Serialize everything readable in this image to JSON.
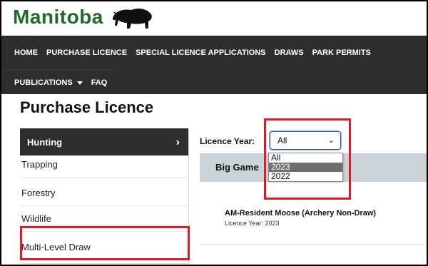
{
  "header": {
    "logo_text": "Manitoba",
    "brand_color": "#1f6b2a"
  },
  "nav": {
    "row1": [
      "HOME",
      "PURCHASE LICENCE",
      "SPECIAL LICENCE APPLICATIONS",
      "DRAWS",
      "PARK PERMITS"
    ],
    "publications_label": "PUBLICATIONS",
    "faq_label": "FAQ",
    "icons": {
      "publications_caret": "caret-down-icon"
    }
  },
  "page": {
    "title": "Purchase Licence"
  },
  "sidebar": {
    "items": [
      {
        "label": "Hunting",
        "active": true,
        "icon": "chevron-right-icon"
      },
      {
        "label": "Trapping"
      },
      {
        "label": "Forestry"
      },
      {
        "label": "Wildlife"
      },
      {
        "label": "Multi-Level Draw",
        "highlighted": true
      }
    ]
  },
  "filter": {
    "year_label": "Licence Year:",
    "selected": "All",
    "options": [
      "All",
      "2023",
      "2022"
    ],
    "hovered_option": "2023",
    "icon": "chevron-down-icon"
  },
  "category": {
    "label": "Big Game"
  },
  "results": [
    {
      "title": "AM-Resident Moose (Archery Non-Draw)",
      "subtitle": "Licence Year: 2023"
    }
  ],
  "colors": {
    "nav_bg": "#2e2e2e",
    "highlight_box": "#e01b24",
    "category_bar": "#c9d3d8"
  }
}
